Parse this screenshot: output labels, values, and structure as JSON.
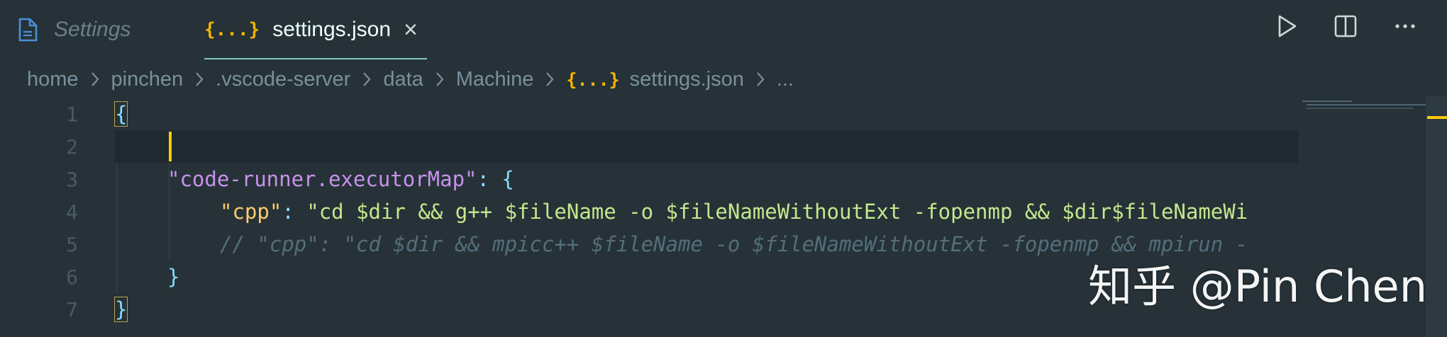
{
  "tabs": [
    {
      "label": "Settings",
      "icon": "file-icon",
      "active": false
    },
    {
      "label": "settings.json",
      "icon": "json-braces-icon",
      "active": true
    }
  ],
  "tab_icon_json": "{...}",
  "actions": [
    "run-icon",
    "split-editor-icon",
    "more-actions-icon"
  ],
  "breadcrumb": {
    "items": [
      "home",
      "pinchen",
      ".vscode-server",
      "data",
      "Machine",
      "settings.json",
      "..."
    ],
    "json_icon": "{...}"
  },
  "editor": {
    "lines": [
      {
        "num": "1",
        "text": "{"
      },
      {
        "num": "2",
        "text": ""
      },
      {
        "num": "3",
        "key": "\"code-runner.executorMap\"",
        "punct": ": ",
        "brace": "{"
      },
      {
        "num": "4",
        "key": "\"cpp\"",
        "punct": ": ",
        "value": "\"cd $dir && g++ $fileName -o $fileNameWithoutExt -fopenmp && $dir$fileNameWi"
      },
      {
        "num": "5",
        "comment": "// \"cpp\": \"cd $dir && mpicc++ $fileName -o $fileNameWithoutExt -fopenmp && mpirun -"
      },
      {
        "num": "6",
        "text": "}"
      },
      {
        "num": "7",
        "text": "}"
      }
    ]
  },
  "watermark": "知乎 @Pin Chen",
  "colors": {
    "background": "#263238",
    "accent_cursor": "#ffcc00",
    "json_icon": "#f4b400",
    "key": "#c792ea",
    "string": "#c3e88d",
    "comment": "#546e7a"
  }
}
